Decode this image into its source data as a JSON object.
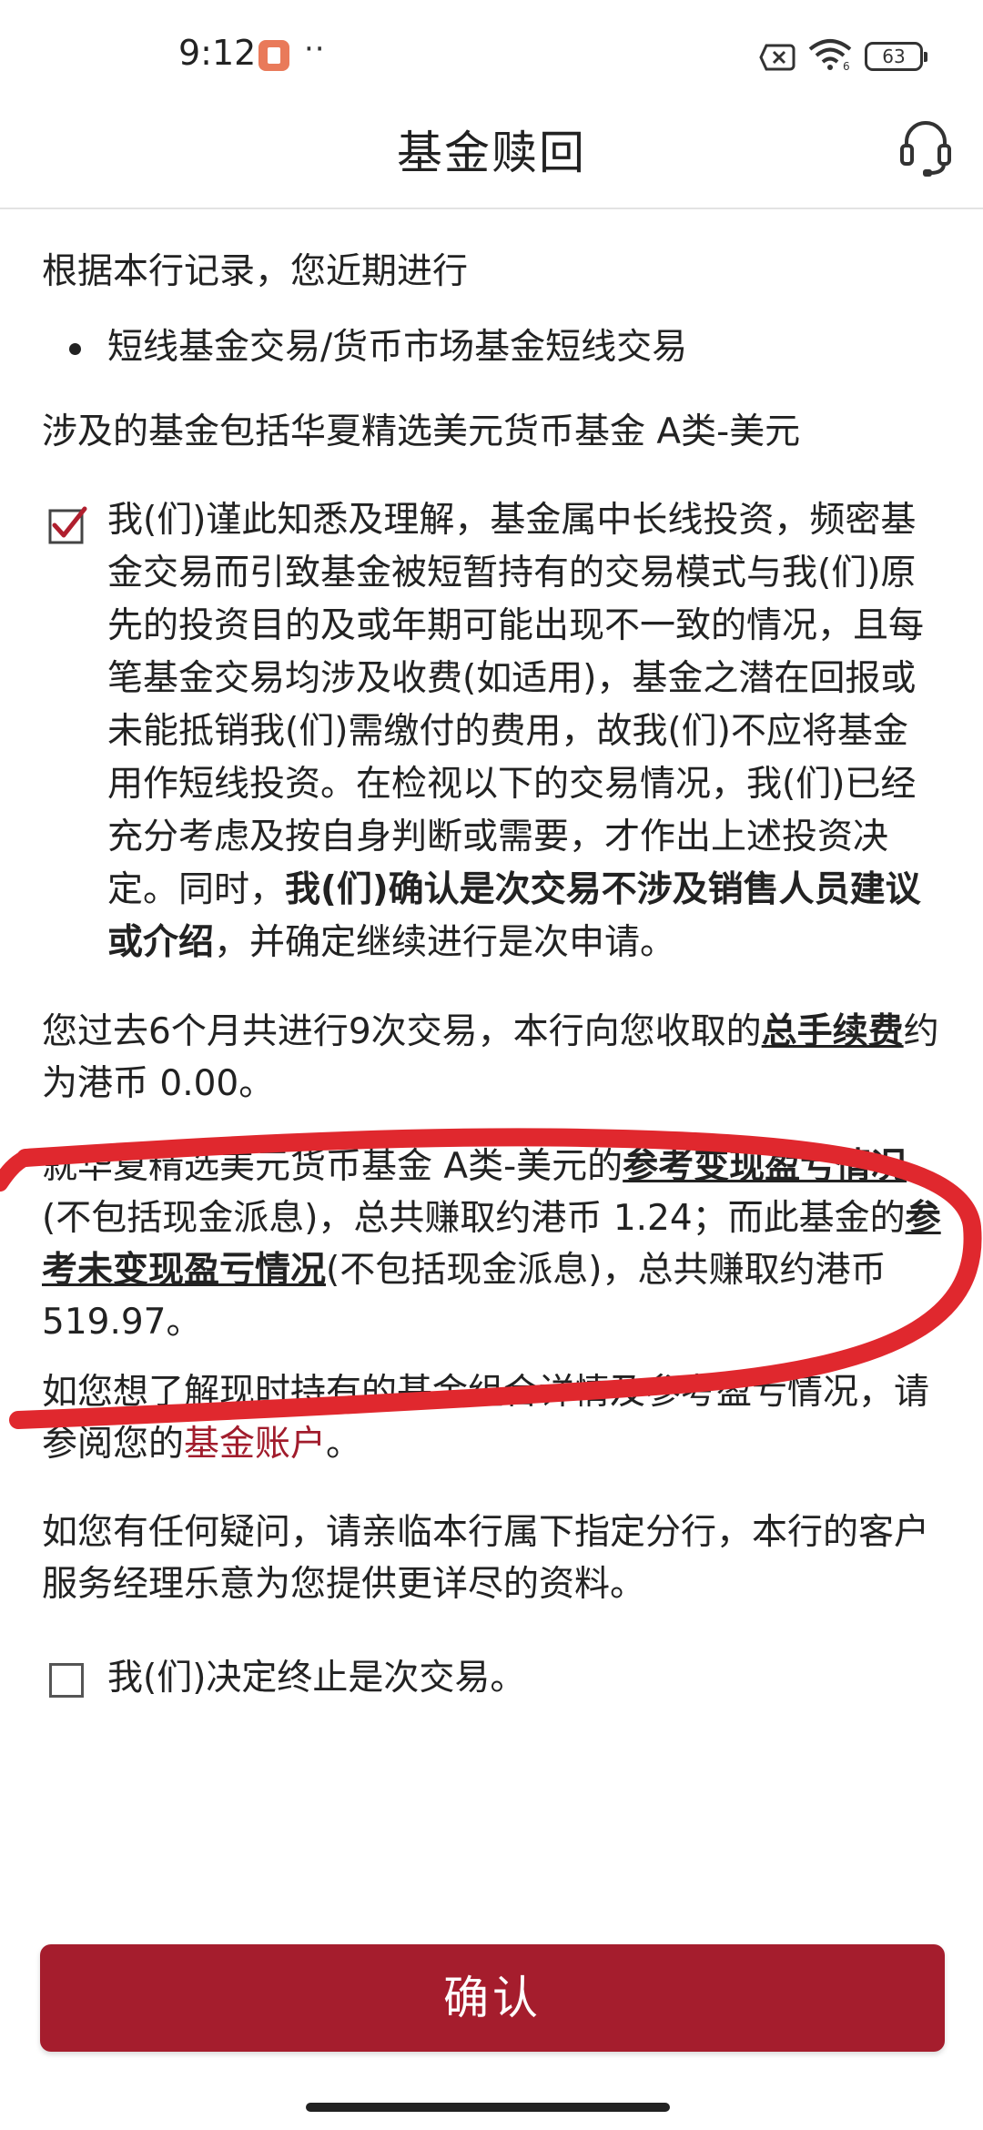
{
  "status_bar": {
    "time": "9:12",
    "more": "··",
    "battery": "63"
  },
  "header": {
    "title": "基金赎回"
  },
  "content": {
    "intro": "根据本行记录，您近期进行",
    "bullet": "短线基金交易/货币市场基金短线交易",
    "fund_involved": "涉及的基金包括华夏精选美元货币基金 A类-美元",
    "acknowledgement": {
      "checked": true,
      "text": "我(们)谨此知悉及理解，基金属中长线投资，频密基金交易而引致基金被短暂持有的交易模式与我(们)原先的投资目的及或年期可能出现不一致的情况，且每笔基金交易均涉及收费(如适用)，基金之潜在回报或未能抵销我(们)需缴付的费用，故我(们)不应将基金用作短线投资。在检视以下的交易情况，我(们)已经充分考虑及按自身判断或需要，才作出上述投资决定。同时，",
      "bold_text": "我(们)确认是次交易不涉及销售人员建议或介绍",
      "tail": "，并确定继续进行是次申请。"
    },
    "fees": {
      "prefix": "您过去6个月共进行9次交易，本行向您收取的",
      "label": "总手续费",
      "suffix": "约为港币 0.00。"
    },
    "profit_loss": {
      "prefix": "就华夏精选美元货币基金 A类-美元的",
      "realized_label": "参考变现盈亏情况",
      "realized_text": "(不包括现金派息)，总共赚取约港币 1.24；而此基金的",
      "unrealized_label": "参考未变现盈亏情况",
      "unrealized_text": "(不包括现金派息)，总共赚取约港币 519.97。"
    },
    "portfolio": {
      "prefix": "如您想了解现时持有的基金组合详情及参考盈亏情况，请参阅您的",
      "link": "基金账户",
      "suffix": "。"
    },
    "contact": "如您有任何疑问，请亲临本行属下指定分行，本行的客户服务经理乐意为您提供更详尽的资料。",
    "terminate": {
      "checked": false,
      "label": "我(们)决定终止是次交易。"
    }
  },
  "confirm_button": {
    "label": "确认"
  },
  "colors": {
    "brand_red": "#a51d2d",
    "link_red": "#a11c2c",
    "annotation_red": "#e0282e"
  }
}
